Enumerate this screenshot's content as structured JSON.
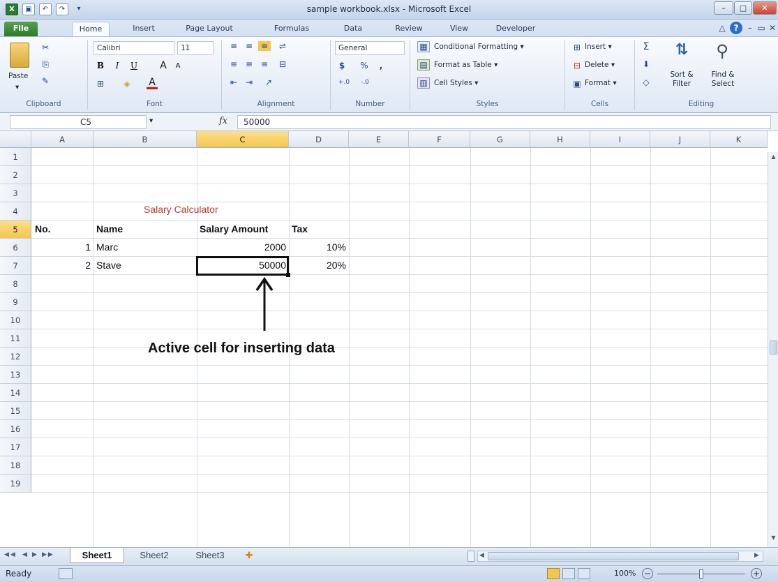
{
  "window": {
    "title": "sample workbook.xlsx - Microsoft Excel",
    "minimize": "–",
    "maximize": "□",
    "close": "✕"
  },
  "quick_access": {
    "excel": "X",
    "save": "▣",
    "undo": "↶",
    "redo": "↷",
    "customize": "▾"
  },
  "ribbon_tabs": [
    "File",
    "Home",
    "Insert",
    "Page Layout",
    "Formulas",
    "Data",
    "Review",
    "View",
    "Developer"
  ],
  "ribbon_right": {
    "collapse": "△",
    "help": "?",
    "min": "–",
    "restore": "▭",
    "close": "✕"
  },
  "ribbon": {
    "clipboard": {
      "paste": "Paste",
      "cut": "✂",
      "copy": "⎘",
      "painter": "✎",
      "label": "Clipboard"
    },
    "font": {
      "name": "Calibri",
      "size": "11",
      "bold": "B",
      "italic": "I",
      "underline": "U",
      "grow": "A",
      "shrink": "A",
      "border": "⊞",
      "fill": "◈",
      "color": "A",
      "label": "Font"
    },
    "alignment": {
      "top": "≡",
      "middle": "≡",
      "bottom": "≡",
      "wrap": "⇌",
      "left": "≡",
      "center": "≡",
      "right": "≡",
      "merge": "⊟",
      "outdent": "⇤",
      "indent": "⇥",
      "orient": "↗",
      "label": "Alignment"
    },
    "number": {
      "format": "General",
      "currency": "$",
      "percent": "%",
      "comma": ",",
      "inc": "+.0",
      "dec": "-.0",
      "label": "Number"
    },
    "styles": {
      "conditional": "Conditional Formatting",
      "table": "Format as Table",
      "cell": "Cell Styles",
      "label": "Styles"
    },
    "cells": {
      "insert": "Insert",
      "delete": "Delete",
      "format": "Format",
      "label": "Cells"
    },
    "editing": {
      "sum": "Σ",
      "fill": "⬇",
      "clear": "◇",
      "sort": "Sort & Filter",
      "find": "Find & Select",
      "label": "Editing"
    }
  },
  "formula_bar": {
    "name_box": "C5",
    "fx": "fx",
    "value": "50000"
  },
  "columns": [
    "A",
    "B",
    "C",
    "D",
    "E",
    "F",
    "G",
    "H",
    "I",
    "J",
    "K"
  ],
  "rows": [
    "1",
    "2",
    "3",
    "4",
    "5",
    "6",
    "7",
    "8",
    "9",
    "10",
    "11",
    "12",
    "13",
    "14",
    "15",
    "16",
    "17",
    "18",
    "19"
  ],
  "cells": {
    "title": "Salary Calculator",
    "headers": {
      "no": "No.",
      "name": "Name",
      "salary": "Salary Amount",
      "tax": "Tax"
    },
    "data": [
      {
        "no": "1",
        "name": "Marc",
        "salary": "2000",
        "tax": "10%"
      },
      {
        "no": "2",
        "name": "Stave",
        "salary": "50000",
        "tax": "20%"
      }
    ]
  },
  "annotation": {
    "text": "Active cell for inserting data"
  },
  "sheets": [
    "Sheet1",
    "Sheet2",
    "Sheet3"
  ],
  "sheet_nav": [
    "◀◀",
    "◀",
    "▶",
    "▶▶"
  ],
  "status": {
    "ready": "Ready",
    "zoom": "100%",
    "zoom_out": "−",
    "zoom_in": "+"
  },
  "colors": {
    "accent": "#2f7a2b",
    "title_red": "#c0392b",
    "selected_header": "#f5c64d"
  }
}
